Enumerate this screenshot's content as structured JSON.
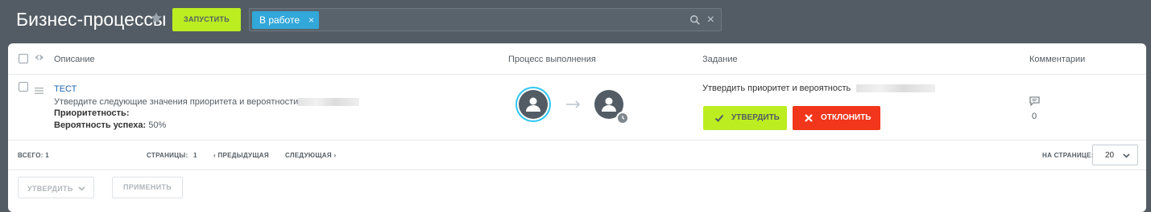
{
  "header": {
    "title": "Бизнес-процессы",
    "start_button": "ЗАПУСТИТЬ",
    "filter_tag": "В работе",
    "tag_close": "×",
    "clear": "×"
  },
  "table": {
    "columns": {
      "description": "Описание",
      "process": "Процесс выполнения",
      "task": "Задание",
      "comments": "Комментарии"
    },
    "row": {
      "name": "ТЕСТ",
      "description": "Утвердите следующие значения приоритета и вероятности",
      "priority_label": "Приоритетность:",
      "probability_label": "Вероятность успеха:",
      "probability_value": "50%",
      "task_text": "Утвердить приоритет и вероятность",
      "approve_button": "УТВЕРДИТЬ",
      "reject_button": "ОТКЛОНИТЬ",
      "comments_count": "0"
    }
  },
  "footer": {
    "total_label": "ВСЕГО:",
    "total_value": "1",
    "pages_label": "СТРАНИЦЫ:",
    "pages_value": "1",
    "prev": "‹ ПРЕДЫДУЩАЯ",
    "next": "СЛЕДУЮЩАЯ ›",
    "per_page_label": "НА СТРАНИЦЕ:",
    "per_page_value": "20"
  },
  "actions": {
    "action_select": "УТВЕРДИТЬ",
    "apply_button": "ПРИМЕНИТЬ"
  },
  "colors": {
    "background": "#535c64",
    "accent_green": "#bbed21",
    "reject_red": "#f1361b",
    "tag_blue": "#32a7d9",
    "link_blue": "#2067b0"
  },
  "icons": [
    "star-icon",
    "search-icon",
    "close-icon",
    "gear-icon",
    "menu-icon",
    "user-icon",
    "arrow-right-icon",
    "clock-icon",
    "check-icon",
    "x-icon",
    "comment-icon",
    "chevron-down-icon"
  ]
}
